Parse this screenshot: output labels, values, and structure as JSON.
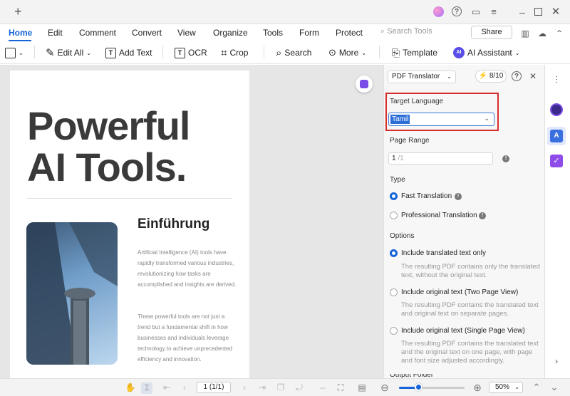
{
  "window": {
    "new_tab": "+"
  },
  "menu": {
    "items": [
      "Home",
      "Edit",
      "Comment",
      "Convert",
      "View",
      "Organize",
      "Tools",
      "Form",
      "Protect"
    ],
    "search_placeholder": "Search Tools",
    "share": "Share"
  },
  "toolbar": {
    "edit_all": "Edit All",
    "add_text": "Add Text",
    "ocr": "OCR",
    "crop": "Crop",
    "search": "Search",
    "more": "More",
    "template": "Template",
    "ai_assistant": "AI Assistant",
    "ai_badge": "AI"
  },
  "document": {
    "title_line1": "Powerful",
    "title_line2": "AI Tools.",
    "heading": "Einführung",
    "para1": "Artificial Intelligence (AI) tools have rapidly transformed various industries, revolutionizing how tasks are accomplished and insights are derived.",
    "para2": "These powerful tools are not just a trend but a fundamental shift in how businesses and individuals leverage technology to achieve unprecedented efficiency and innovation."
  },
  "panel": {
    "tool_select": "PDF Translator",
    "credits": "8/10",
    "target_language_label": "Target Language",
    "target_language_value": "Tamil",
    "page_range_label": "Page Range",
    "page_range_value": "1",
    "page_range_total": "/1",
    "type_label": "Type",
    "type_options": [
      "Fast Translation",
      "Professional Translation"
    ],
    "type_selected": "Fast Translation",
    "options_label": "Options",
    "options": [
      {
        "label": "Include translated text only",
        "desc": "The resulting PDF contains only the translated text, without the original text."
      },
      {
        "label": "Include original text (Two Page View)",
        "desc": "The resulting PDF contains the translated text and original text on separate pages."
      },
      {
        "label": "Include original text (Single Page View)",
        "desc": "The resulting PDF contains the translated text and the original text on one page, with page and font size adjusted accordingly."
      }
    ],
    "options_selected": "Include translated text only",
    "cut_label": "Output Folder"
  },
  "statusbar": {
    "page_indicator": "1 (1/1)",
    "zoom": "50%",
    "zoom_level": 0.3
  },
  "colors": {
    "accent": "#1664d9",
    "highlight_border": "#d62d2d"
  }
}
